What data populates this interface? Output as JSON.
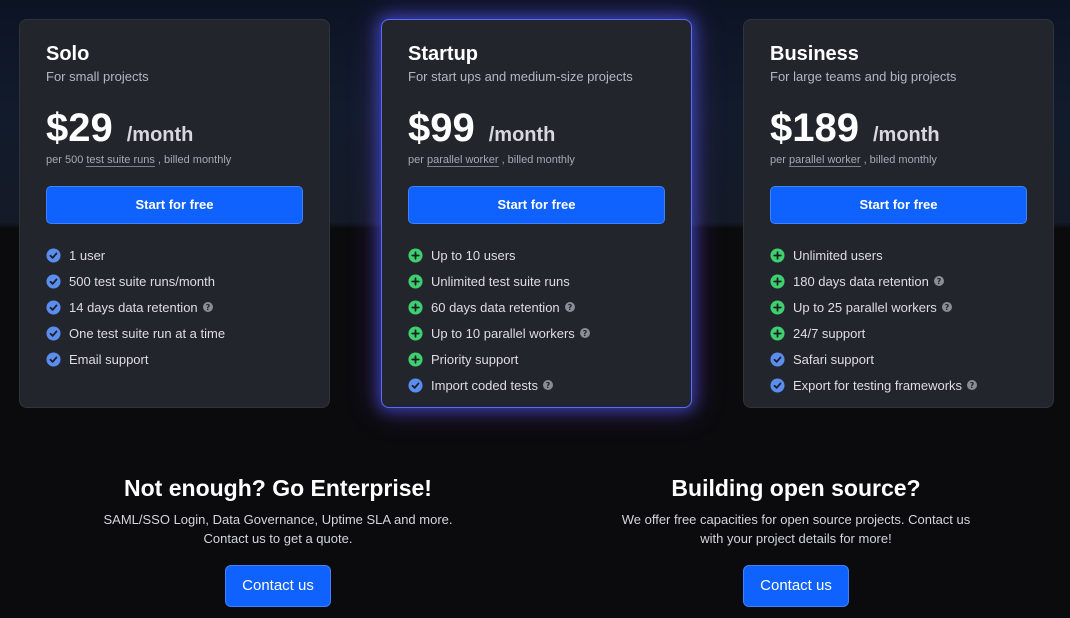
{
  "plans": [
    {
      "title": "Solo",
      "subtitle": "For small projects",
      "price": "$29",
      "period": "/month",
      "billing_prefix": "per 500",
      "billing_link": "test suite runs",
      "billing_suffix": ", billed monthly",
      "cta": "Start for free",
      "features": [
        {
          "text": "1 user",
          "icon": "check-circle-icon",
          "help": false
        },
        {
          "text": "500 test suite runs/month",
          "icon": "check-circle-icon",
          "help": false
        },
        {
          "text": "14 days data retention",
          "icon": "check-circle-icon",
          "help": true
        },
        {
          "text": "One test suite run at a time",
          "icon": "check-circle-icon",
          "help": false
        },
        {
          "text": "Email support",
          "icon": "check-circle-icon",
          "help": false
        }
      ]
    },
    {
      "title": "Startup",
      "subtitle": "For start ups and medium-size projects",
      "price": "$99",
      "period": "/month",
      "billing_prefix": "per",
      "billing_link": "parallel worker",
      "billing_suffix": ", billed monthly",
      "cta": "Start for free",
      "features": [
        {
          "text": "Up to 10 users",
          "icon": "plus-circle-icon",
          "help": false
        },
        {
          "text": "Unlimited test suite runs",
          "icon": "plus-circle-icon",
          "help": false
        },
        {
          "text": "60 days data retention",
          "icon": "plus-circle-icon",
          "help": true
        },
        {
          "text": "Up to 10 parallel workers",
          "icon": "plus-circle-icon",
          "help": true
        },
        {
          "text": "Priority support",
          "icon": "plus-circle-icon",
          "help": false
        },
        {
          "text": "Import coded tests",
          "icon": "check-circle-icon",
          "help": true
        }
      ]
    },
    {
      "title": "Business",
      "subtitle": "For large teams and big projects",
      "price": "$189",
      "period": "/month",
      "billing_prefix": "per",
      "billing_link": "parallel worker",
      "billing_suffix": ", billed monthly",
      "cta": "Start for free",
      "features": [
        {
          "text": "Unlimited users",
          "icon": "plus-circle-icon",
          "help": false
        },
        {
          "text": "180 days data retention",
          "icon": "plus-circle-icon",
          "help": true
        },
        {
          "text": "Up to 25 parallel workers",
          "icon": "plus-circle-icon",
          "help": true
        },
        {
          "text": "24/7 support",
          "icon": "plus-circle-icon",
          "help": false
        },
        {
          "text": "Safari support",
          "icon": "check-circle-icon",
          "help": false
        },
        {
          "text": "Export for testing frameworks",
          "icon": "check-circle-icon",
          "help": true
        }
      ]
    }
  ],
  "enterprise": {
    "title": "Not enough? Go Enterprise!",
    "line1": "SAML/SSO Login, Data Governance, Uptime SLA and more.",
    "line2": "Contact us to get a quote.",
    "button": "Contact us"
  },
  "open_source": {
    "title": "Building open source?",
    "line1": "We offer free capacities for open source projects. Contact us",
    "line2": "with your project details for more!",
    "button": "Contact us"
  },
  "colors": {
    "accent": "#0f62fe",
    "check": "#5b8def",
    "plus": "#3ecf6e",
    "card": "#23252d"
  }
}
